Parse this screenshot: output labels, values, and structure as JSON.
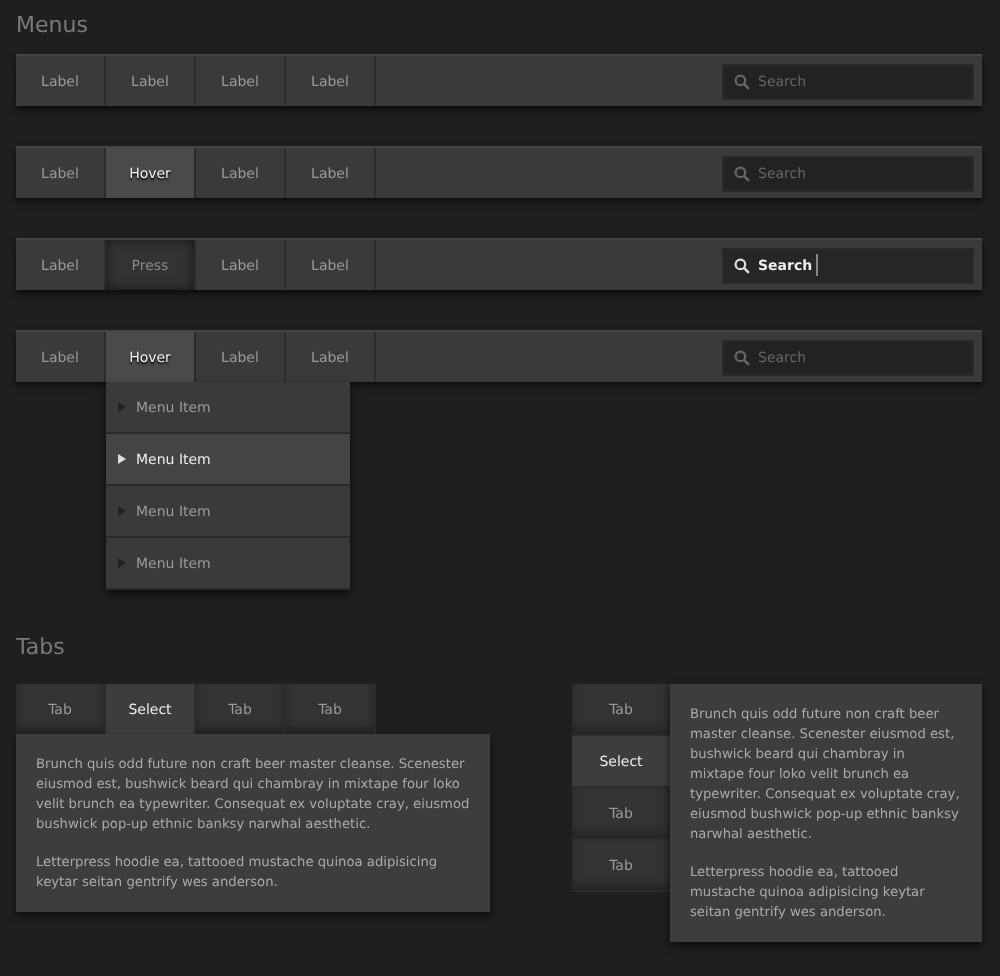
{
  "menus_title": "Menus",
  "menubars": [
    {
      "items": [
        {
          "label": "Label",
          "hovered": false,
          "pressed": false
        },
        {
          "label": "Label",
          "hovered": false,
          "pressed": false
        },
        {
          "label": "Label",
          "hovered": false,
          "pressed": false
        },
        {
          "label": "Label",
          "hovered": false,
          "pressed": false
        }
      ],
      "search": {
        "placeholder": "Search"
      }
    },
    {
      "items": [
        {
          "label": "Label",
          "hovered": false,
          "pressed": false
        },
        {
          "label": "Hover",
          "hovered": true,
          "pressed": false
        },
        {
          "label": "Label",
          "hovered": false,
          "pressed": false
        },
        {
          "label": "Label",
          "hovered": false,
          "pressed": false
        }
      ],
      "search": {
        "placeholder": "Search"
      }
    },
    {
      "items": [
        {
          "label": "Label",
          "hovered": false,
          "pressed": false
        },
        {
          "label": "Press",
          "hovered": false,
          "pressed": true
        },
        {
          "label": "Label",
          "hovered": false,
          "pressed": false
        },
        {
          "label": "Label",
          "hovered": false,
          "pressed": false
        }
      ],
      "search": {
        "value": "Search"
      }
    },
    {
      "items": [
        {
          "label": "Label",
          "hovered": false,
          "pressed": false
        },
        {
          "label": "Hover",
          "hovered": true,
          "pressed": false,
          "dropdown": [
            {
              "label": "Menu Item",
              "hovered": false
            },
            {
              "label": "Menu Item",
              "hovered": true
            },
            {
              "label": "Menu Item",
              "hovered": false
            },
            {
              "label": "Menu Item",
              "hovered": false
            }
          ]
        },
        {
          "label": "Label",
          "hovered": false,
          "pressed": false
        },
        {
          "label": "Label",
          "hovered": false,
          "pressed": false
        }
      ],
      "search": {
        "placeholder": "Search"
      }
    }
  ],
  "tabs_title": "Tabs",
  "horizontal_tabs": {
    "tabs": [
      {
        "label": "Tab",
        "selected": false
      },
      {
        "label": "Select",
        "selected": true
      },
      {
        "label": "Tab",
        "selected": false
      },
      {
        "label": "Tab",
        "selected": false
      }
    ],
    "paragraphs": [
      "Brunch quis odd future non craft beer master cleanse. Scenester eiusmod est, bushwick beard qui chambray in mixtape four loko velit brunch ea typewriter. Consequat ex voluptate cray, eiusmod bushwick pop-up ethnic banksy narwhal aesthetic.",
      "Letterpress hoodie ea, tattooed mustache quinoa adipisicing keytar seitan gentrify wes anderson."
    ]
  },
  "vertical_tabs": {
    "tabs": [
      {
        "label": "Tab",
        "selected": false
      },
      {
        "label": "Select",
        "selected": true
      },
      {
        "label": "Tab",
        "selected": false
      },
      {
        "label": "Tab",
        "selected": false
      }
    ],
    "paragraphs": [
      "Brunch quis odd future non craft beer master cleanse. Scenester eiusmod est, bushwick beard qui chambray in mixtape four loko velit brunch ea typewriter. Consequat ex voluptate cray, eiusmod bushwick pop-up ethnic banksy narwhal aesthetic.",
      "Letterpress hoodie ea, tattooed mustache quinoa adipisicing keytar seitan gentrify wes anderson."
    ]
  }
}
